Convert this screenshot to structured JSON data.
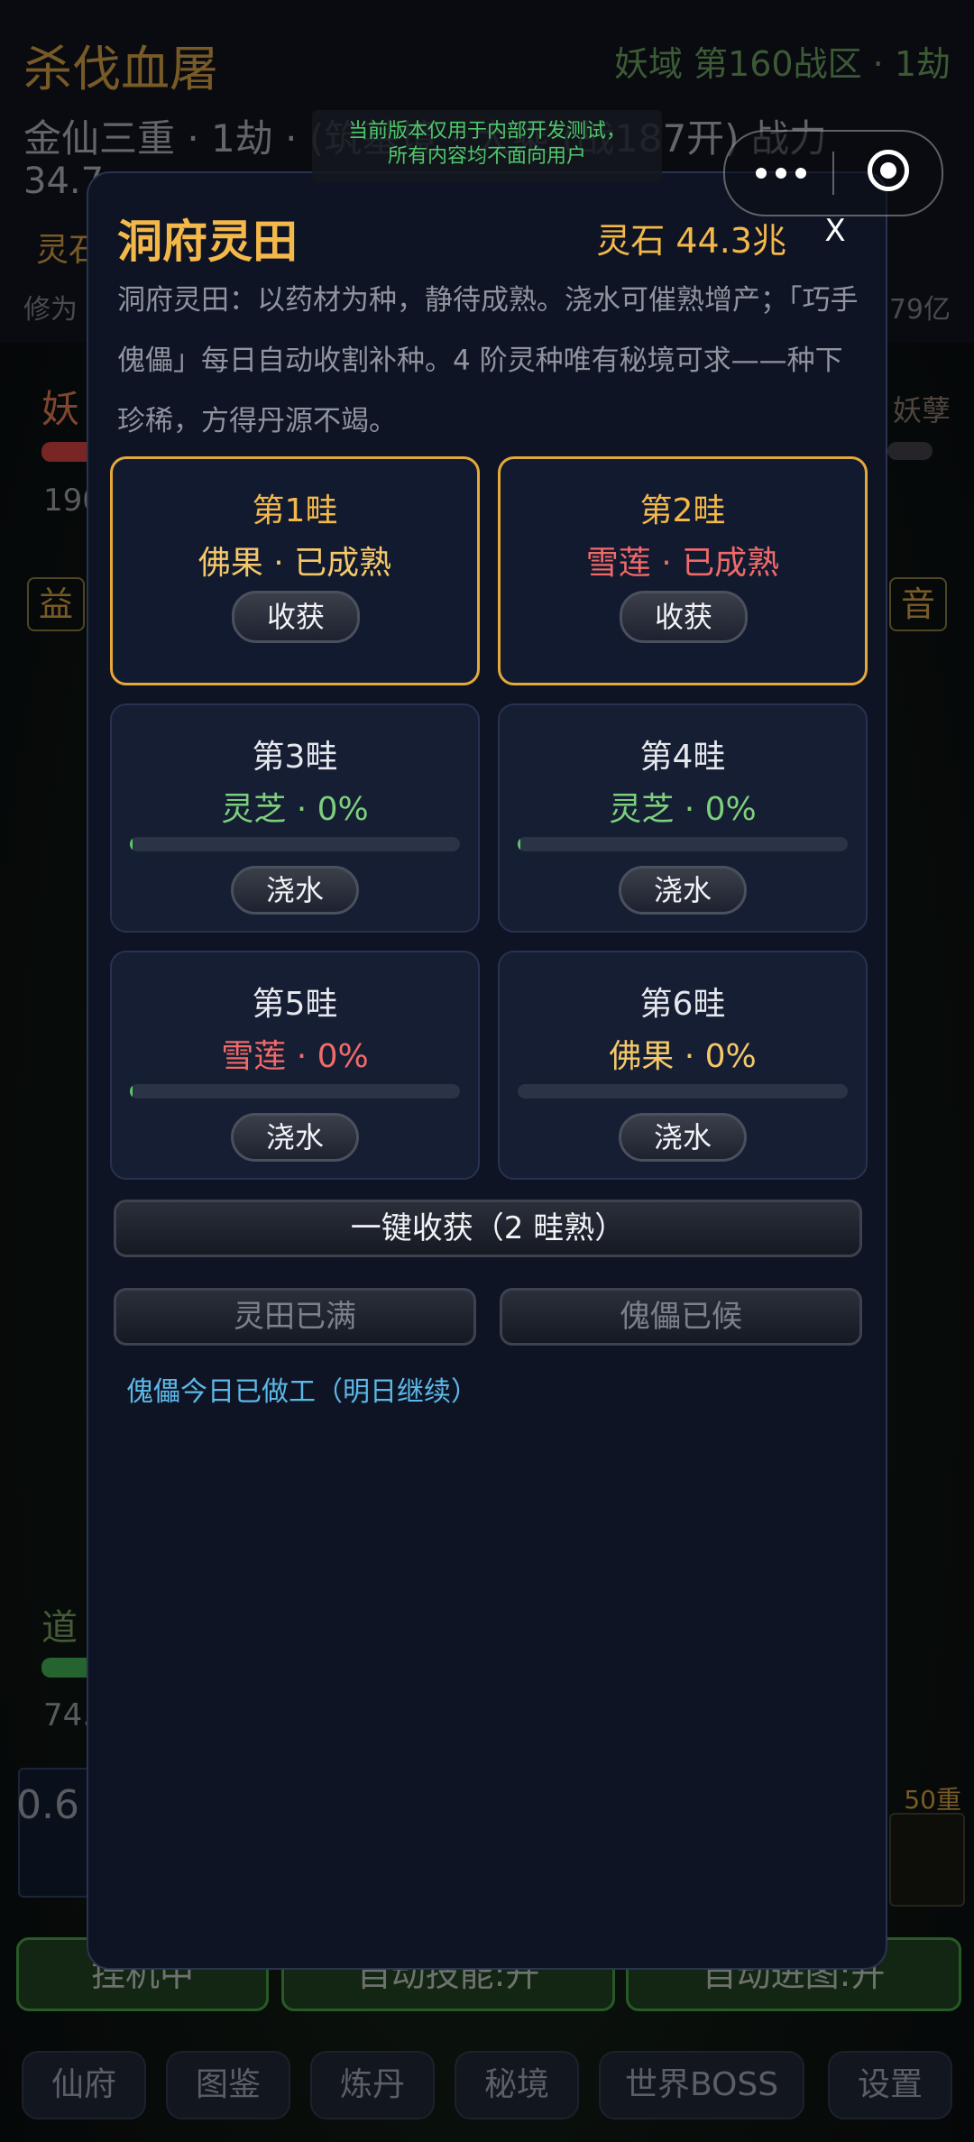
{
  "background": {
    "game_title": "杀伐血屠",
    "zone": "妖域 第160战区 · 1劫",
    "realm_line": "金仙三重 · 1劫 · (筑基境 · 大乘 (战187开) 战力",
    "power_value": "34.7",
    "lingshi_label": "灵石",
    "xiuwei_label": "修为",
    "xiuwei_value": "179亿",
    "left_label": "妖",
    "left_value": "190",
    "right_label": "妖孽",
    "button_yi": "益",
    "button_yin": "音",
    "dao_label": "道",
    "dao_value": "74.",
    "speed_value": "0.6",
    "layer_badge": "50重",
    "auto_buttons": [
      "挂机中",
      "自动技能:开",
      "自动进图:开"
    ],
    "nav": [
      "仙府",
      "图鉴",
      "炼丹",
      "秘境",
      "世界BOSS",
      "设置"
    ]
  },
  "dev_notice": {
    "line1": "当前版本仅用于内部开发测试，",
    "line2": "所有内容均不面向用户"
  },
  "modal": {
    "title": "洞府灵田",
    "balance": "灵石 44.3兆",
    "close_label": "X",
    "description": "洞府灵田：以药材为种，静待成熟。浇水可催熟增产；「巧手傀儡」每日自动收割补种。4 阶灵种唯有秘境可求——种下珍稀，方得丹源不竭。",
    "plots": [
      {
        "name": "第1畦",
        "crop": "佛果",
        "sep": "·",
        "status": "已成熟",
        "button": "收获",
        "progress": 1.0,
        "color": "#f4c86a"
      },
      {
        "name": "第2畦",
        "crop": "雪莲",
        "sep": "·",
        "status": "已成熟",
        "button": "收获",
        "progress": 1.0,
        "color": "#f06a6a"
      },
      {
        "name": "第3畦",
        "crop": "灵芝",
        "sep": "·",
        "status": "0%",
        "button": "浇水",
        "progress": 0.0,
        "color": "#7ccf7c"
      },
      {
        "name": "第4畦",
        "crop": "灵芝",
        "sep": "·",
        "status": "0%",
        "button": "浇水",
        "progress": 0.0,
        "color": "#7ccf7c"
      },
      {
        "name": "第5畦",
        "crop": "雪莲",
        "sep": "·",
        "status": "0%",
        "button": "浇水",
        "progress": 0.0,
        "color": "#f06a6a"
      },
      {
        "name": "第6畦",
        "crop": "佛果",
        "sep": "·",
        "status": "0%",
        "button": "浇水",
        "progress": 0.0,
        "color": "#f4c86a"
      }
    ],
    "harvest_all": "一键收获（2 畦熟）",
    "field_full": "灵田已满",
    "puppet_ready": "傀儡已候",
    "puppet_note": "傀儡今日已做工（明日继续）"
  }
}
